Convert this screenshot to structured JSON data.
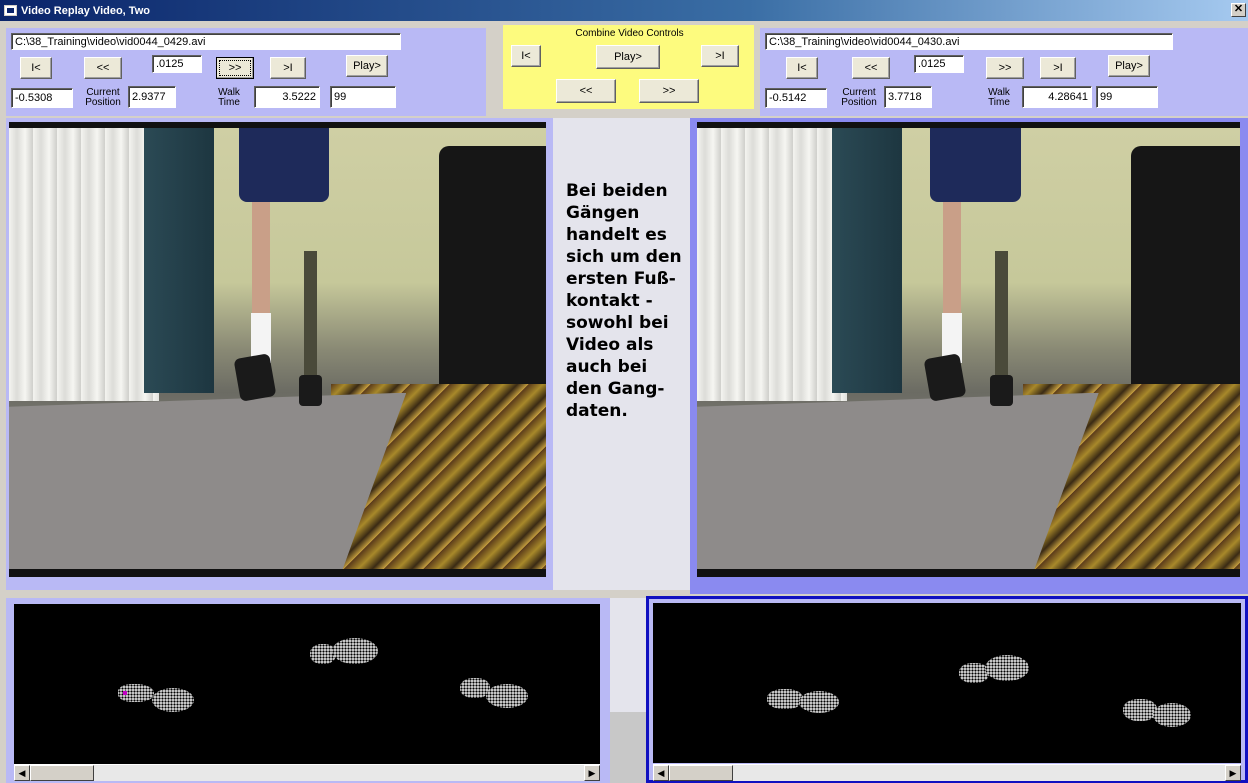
{
  "window": {
    "title": "Video Replay Video, Two",
    "close_glyph": "✕"
  },
  "left_controls": {
    "file_path": "C:\\38_Training\\video\\vid0044_0429.avi",
    "btn_start": "I<",
    "btn_back": "<<",
    "step_value": ".0125",
    "btn_fwd": ">>",
    "btn_end": ">I",
    "btn_play": "Play>",
    "offset_value": "-0.5308",
    "current_position_label": "Current\nPosition",
    "current_position_value": "2.9377",
    "walk_time_label": "Walk\nTime",
    "walk_time_value": "3.5222",
    "extra_value": "99"
  },
  "combine_controls": {
    "title": "Combine Video Controls",
    "btn_start": "I<",
    "btn_play": "Play>",
    "btn_end": ">I",
    "btn_back": "<<",
    "btn_fwd": ">>"
  },
  "right_controls": {
    "file_path": "C:\\38_Training\\video\\vid0044_0430.avi",
    "btn_start": "I<",
    "btn_back": "<<",
    "step_value": ".0125",
    "btn_fwd": ">>",
    "btn_end": ">I",
    "btn_play": "Play>",
    "offset_value": "-0.5142",
    "current_position_label": "Current\nPosition",
    "current_position_value": "3.7718",
    "walk_time_label": "Walk\nTime",
    "walk_time_value": "4.28641",
    "extra_value": "99"
  },
  "annotation": {
    "text": "Bei beiden Gängen handelt es sich um den ersten Fuß-kontakt - sowohl bei Video als auch bei den Gang-daten."
  },
  "scrollbars": {
    "left_arrow": "◀",
    "right_arrow": "▶"
  },
  "colors": {
    "panel_lavender": "#b9b9f5",
    "combine_yellow": "#fdfb7e",
    "footprint_bg": "#000000",
    "selected_frame_border": "#1010c0"
  }
}
